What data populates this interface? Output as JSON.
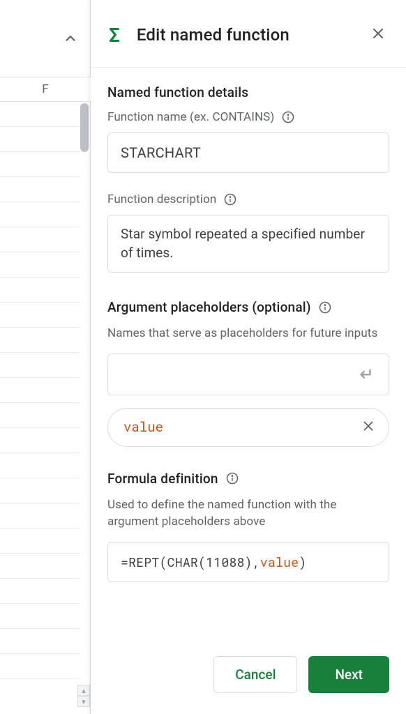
{
  "sheet": {
    "column_label": "F"
  },
  "panel": {
    "title": "Edit named function"
  },
  "details": {
    "section_title": "Named function details",
    "name_label": "Function name (ex. CONTAINS)",
    "name_value": "STARCHART",
    "desc_label": "Function description",
    "desc_value": "Star symbol repeated a specified number of times."
  },
  "args": {
    "section_title": "Argument placeholders (optional)",
    "help_text": "Names that serve as placeholders for future inputs",
    "input_value": "",
    "chip_label": "value"
  },
  "formula": {
    "section_title": "Formula definition",
    "help_text": "Used to define the named function with the argument placeholders above",
    "prefix": "=REPT(CHAR(11088),",
    "arg": "value",
    "suffix": ")"
  },
  "footer": {
    "cancel": "Cancel",
    "next": "Next"
  }
}
